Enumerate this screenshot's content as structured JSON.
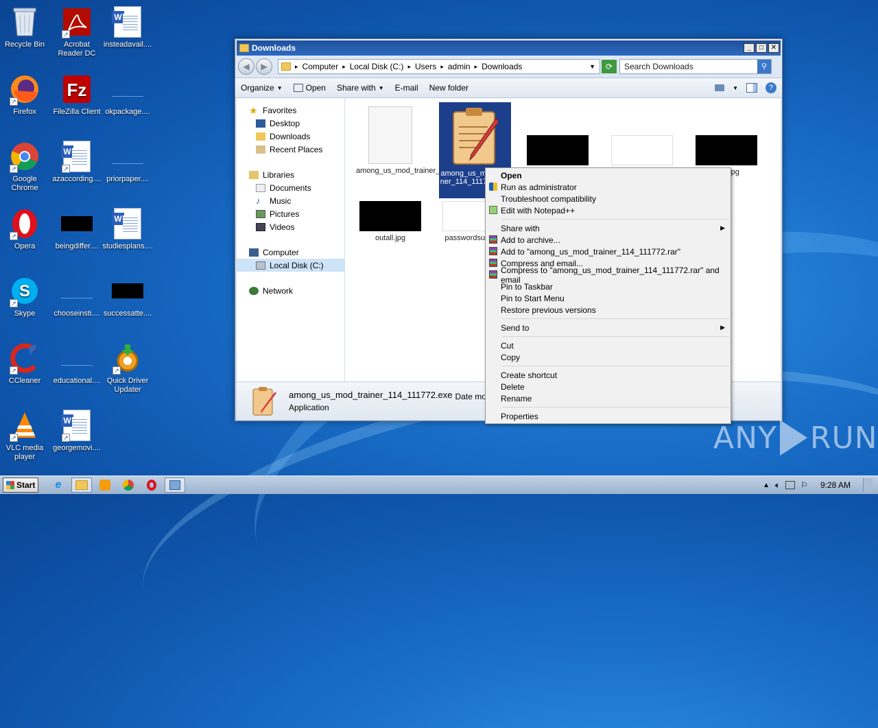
{
  "desktop": {
    "icons": [
      {
        "label": "Recycle Bin",
        "icon": "recycle-bin-icon"
      },
      {
        "label": "Acrobat Reader DC",
        "icon": "acrobat-icon"
      },
      {
        "label": "insteadavail....",
        "icon": "word-doc-icon"
      },
      {
        "label": "Firefox",
        "icon": "firefox-icon"
      },
      {
        "label": "FileZilla Client",
        "icon": "filezilla-icon"
      },
      {
        "label": "okpackage....",
        "icon": "blank-file-icon"
      },
      {
        "label": "Google Chrome",
        "icon": "chrome-icon"
      },
      {
        "label": "azaccording....",
        "icon": "word-doc-icon"
      },
      {
        "label": "priorpaper....",
        "icon": "blank-file-icon"
      },
      {
        "label": "Opera",
        "icon": "opera-icon"
      },
      {
        "label": "beingdiffer....",
        "icon": "black-image-icon"
      },
      {
        "label": "studiesplans....",
        "icon": "word-doc-icon"
      },
      {
        "label": "Skype",
        "icon": "skype-icon"
      },
      {
        "label": "chooseinsti....",
        "icon": "blank-file-icon"
      },
      {
        "label": "successatte....",
        "icon": "black-image-icon"
      },
      {
        "label": "CCleaner",
        "icon": "ccleaner-icon"
      },
      {
        "label": "educational....",
        "icon": "blank-file-icon"
      },
      {
        "label": "Quick Driver Updater",
        "icon": "quick-driver-icon"
      },
      {
        "label": "VLC media player",
        "icon": "vlc-icon"
      },
      {
        "label": "georgemovi....",
        "icon": "word-doc-icon"
      }
    ]
  },
  "window": {
    "title": "Downloads",
    "breadcrumb": [
      "Computer",
      "Local Disk (C:)",
      "Users",
      "admin",
      "Downloads"
    ],
    "search_placeholder": "Search Downloads",
    "toolbar": {
      "organize": "Organize",
      "open": "Open",
      "share_with": "Share with",
      "email": "E-mail",
      "new_folder": "New folder"
    },
    "nav": {
      "favorites": "Favorites",
      "desktop": "Desktop",
      "downloads": "Downloads",
      "recent": "Recent Places",
      "libraries": "Libraries",
      "documents": "Documents",
      "music": "Music",
      "pictures": "Pictures",
      "videos": "Videos",
      "computer": "Computer",
      "local_disk": "Local Disk (C:)",
      "network": "Network"
    },
    "files": [
      {
        "name": "among_us_mod_trainer_114.exe"
      },
      {
        "name": "among_us_mod_trainer_114_111772.exe"
      },
      {
        "name": ""
      },
      {
        "name": ""
      },
      {
        "name": "affic.jpg"
      },
      {
        "name": "outall.jpg"
      },
      {
        "name": "passwordsur.png"
      }
    ],
    "details": {
      "filename": "among_us_mod_trainer_114_111772.exe",
      "type": "Application",
      "date_label": "Date modi",
      "size_label": "S"
    }
  },
  "context_menu": {
    "items": [
      {
        "label": "Open",
        "bold": true
      },
      {
        "label": "Run as administrator",
        "icon": "shield-icon"
      },
      {
        "label": "Troubleshoot compatibility"
      },
      {
        "label": "Edit with Notepad++",
        "icon": "notepad-icon"
      },
      {
        "sep": true
      },
      {
        "label": "Share with",
        "submenu": true
      },
      {
        "label": "Add to archive...",
        "icon": "winrar-icon"
      },
      {
        "label": "Add to \"among_us_mod_trainer_114_111772.rar\"",
        "icon": "winrar-icon"
      },
      {
        "label": "Compress and email...",
        "icon": "winrar-icon"
      },
      {
        "label": "Compress to \"among_us_mod_trainer_114_111772.rar\" and email",
        "icon": "winrar-icon"
      },
      {
        "label": "Pin to Taskbar"
      },
      {
        "label": "Pin to Start Menu"
      },
      {
        "label": "Restore previous versions"
      },
      {
        "sep": true
      },
      {
        "label": "Send to",
        "submenu": true
      },
      {
        "sep": true
      },
      {
        "label": "Cut"
      },
      {
        "label": "Copy"
      },
      {
        "sep": true
      },
      {
        "label": "Create shortcut"
      },
      {
        "label": "Delete"
      },
      {
        "label": "Rename"
      },
      {
        "sep": true
      },
      {
        "label": "Properties"
      }
    ]
  },
  "taskbar": {
    "start_label": "Start",
    "clock": "9:28 AM"
  },
  "watermark": {
    "left": "ANY",
    "right": "RUN"
  },
  "colors": {
    "selection": "#1c3f8c",
    "accent": "#2e6bc4"
  }
}
